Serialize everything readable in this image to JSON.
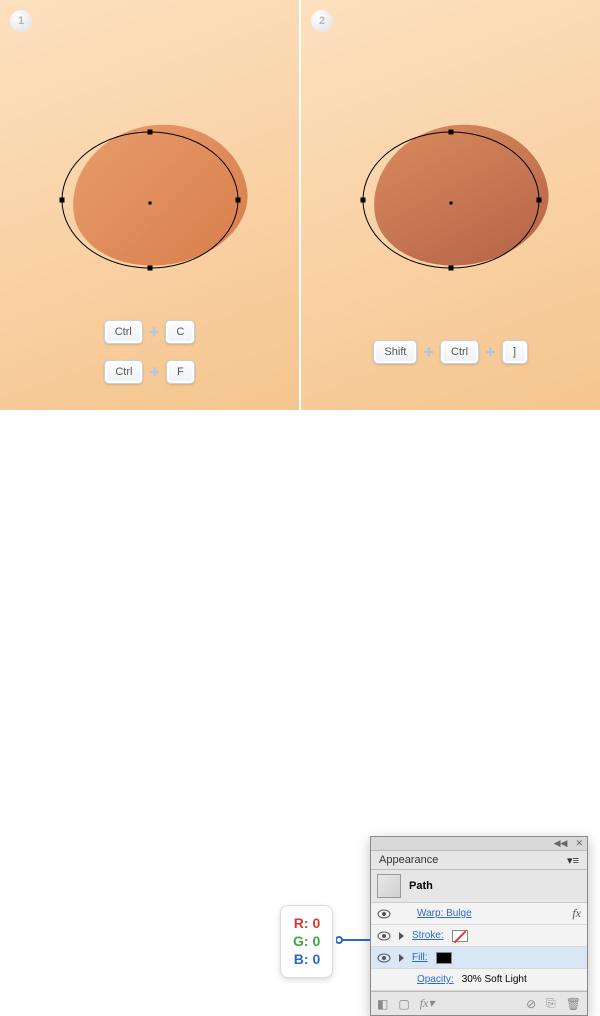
{
  "steps": [
    {
      "num": "1",
      "key_rows": [
        [
          "Ctrl",
          "C"
        ],
        [
          "Ctrl",
          "F"
        ]
      ]
    },
    {
      "num": "2",
      "key_rows": [
        [
          "Shift",
          "Ctrl",
          "]"
        ]
      ]
    }
  ],
  "rgb": {
    "r_label": "R:",
    "r_val": "0",
    "g_label": "G:",
    "g_val": "0",
    "b_label": "B:",
    "b_val": "0"
  },
  "panel": {
    "title": "Appearance",
    "object": "Path",
    "rows": {
      "warp": "Warp: Bulge",
      "stroke": "Stroke:",
      "fill": "Fill:",
      "opacity_label": "Opacity:",
      "opacity_value": "30% Soft Light"
    },
    "fx": "fx"
  }
}
